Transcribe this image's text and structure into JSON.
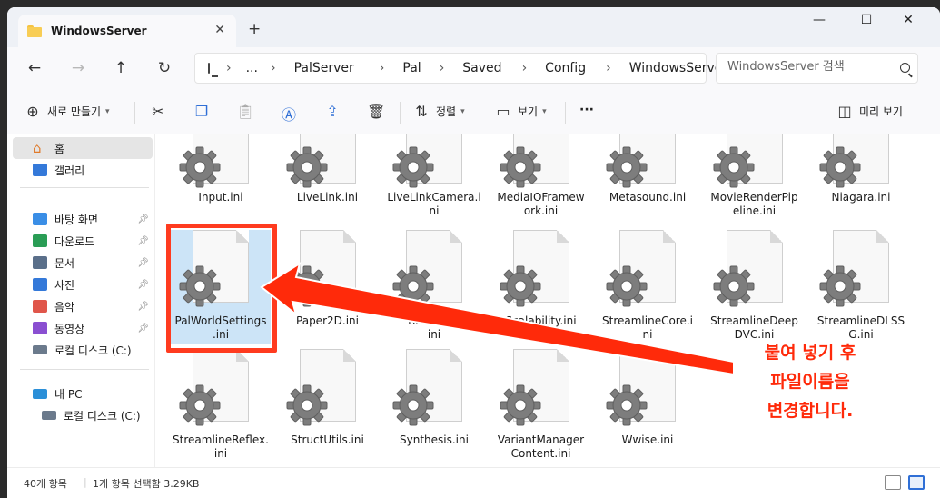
{
  "window": {
    "tab_title": "WindowsServer",
    "tab_close": "✕",
    "new_tab": "+",
    "minimize": "—",
    "maximize": "☐",
    "close": "✕"
  },
  "nav": {
    "back": "←",
    "forward": "→",
    "up": "↑",
    "refresh": "↻",
    "breadcrumb": [
      "...",
      "PalServer",
      "Pal",
      "Saved",
      "Config",
      "WindowsServer"
    ],
    "search_placeholder": "WindowsServer 검색"
  },
  "toolbar": {
    "new_label": "새로 만들기",
    "sort_label": "정렬",
    "view_label": "보기",
    "more": "···",
    "preview_label": "미리 보기"
  },
  "sidebar": {
    "home": "홈",
    "gallery": "갤러리",
    "quick": [
      {
        "label": "바탕 화면",
        "color": "#3a8ee6"
      },
      {
        "label": "다운로드",
        "color": "#2a9d55"
      },
      {
        "label": "문서",
        "color": "#5a6f8a"
      },
      {
        "label": "사진",
        "color": "#3479d9"
      },
      {
        "label": "음악",
        "color": "#e0564a"
      },
      {
        "label": "동영상",
        "color": "#8a4fd1"
      }
    ],
    "local_disk": "로컬 디스크 (C:)",
    "this_pc": "내 PC",
    "this_pc_disk": "로컬 디스크 (C:)"
  },
  "files": [
    {
      "name": "Input.ini"
    },
    {
      "name": "LiveLink.ini"
    },
    {
      "name": "LiveLinkCamera.i\nni"
    },
    {
      "name": "MediaIOFramew\nork.ini"
    },
    {
      "name": "Metasound.ini"
    },
    {
      "name": "MovieRenderPip\neline.ini"
    },
    {
      "name": "Niagara.ini"
    },
    {
      "name": "PalWorldSettings\n.ini",
      "selected": true
    },
    {
      "name": "Paper2D.ini"
    },
    {
      "name": "Runtime..\nini"
    },
    {
      "name": "Scalability.ini"
    },
    {
      "name": "StreamlineCore.i\nni"
    },
    {
      "name": "StreamlineDeep\nDVC.ini"
    },
    {
      "name": "StreamlineDLSS\nG.ini"
    },
    {
      "name": "StreamlineReflex.\nini"
    },
    {
      "name": "StructUtils.ini"
    },
    {
      "name": "Synthesis.ini"
    },
    {
      "name": "VariantManager\nContent.ini"
    },
    {
      "name": "Wwise.ini"
    }
  ],
  "status": {
    "count": "40개 항목",
    "selection": "1개 항목 선택함 3.29KB"
  },
  "annotation": {
    "text": "붙여 넣기 후\n파일이름을\n변경합니다.",
    "color": "#ff2a0a"
  }
}
